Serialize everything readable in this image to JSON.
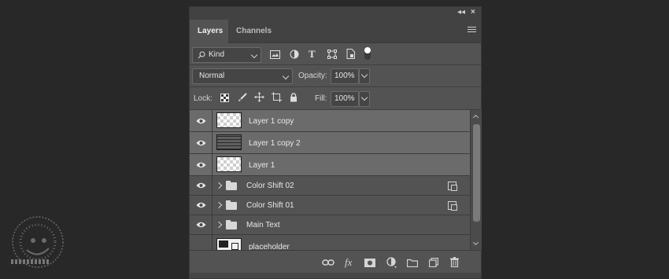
{
  "panel": {
    "tabs": [
      {
        "label": "Layers",
        "active": true
      },
      {
        "label": "Channels",
        "active": false
      }
    ],
    "titlebar_icons": [
      "collapse-icon",
      "close-icon"
    ]
  },
  "filter": {
    "kind_label": "Kind",
    "filter_icons": [
      "pixel-layer-filter-icon",
      "adjustment-layer-filter-icon",
      "type-layer-filter-icon",
      "shape-layer-filter-icon",
      "smart-object-filter-icon",
      "filter-toggle-icon"
    ]
  },
  "blend": {
    "mode": "Normal",
    "opacity_label": "Opacity:",
    "opacity_value": "100%"
  },
  "lock": {
    "label": "Lock:",
    "icons": [
      "lock-transparent-pixels-icon",
      "lock-image-pixels-icon",
      "lock-position-icon",
      "lock-artboard-icon",
      "lock-all-icon"
    ],
    "fill_label": "Fill:",
    "fill_value": "100%"
  },
  "layers": [
    {
      "name": "Layer 1 copy",
      "type": "pixel",
      "thumb": "checker",
      "selected": true,
      "visible": true
    },
    {
      "name": "Layer 1 copy 2",
      "type": "pixel",
      "thumb": "lines",
      "selected": true,
      "visible": true
    },
    {
      "name": "Layer 1",
      "type": "pixel",
      "thumb": "checker",
      "selected": true,
      "visible": true
    },
    {
      "name": "Color Shift 02",
      "type": "group",
      "selected": false,
      "visible": true,
      "clipped": true
    },
    {
      "name": "Color Shift 01",
      "type": "group",
      "selected": false,
      "visible": true,
      "clipped": true
    },
    {
      "name": "Main Text",
      "type": "group",
      "selected": false,
      "visible": true,
      "clipped": false
    },
    {
      "name": "placeholder",
      "type": "smart",
      "selected": false,
      "visible": false
    }
  ],
  "bottom_icons": [
    "link-layers-icon",
    "fx-icon",
    "add-mask-icon",
    "new-adjustment-icon",
    "new-group-icon",
    "new-layer-icon",
    "delete-icon"
  ],
  "colors": {
    "panel_bg": "#535353",
    "selected_row": "#6b6b6b",
    "page_bg": "#282828"
  }
}
